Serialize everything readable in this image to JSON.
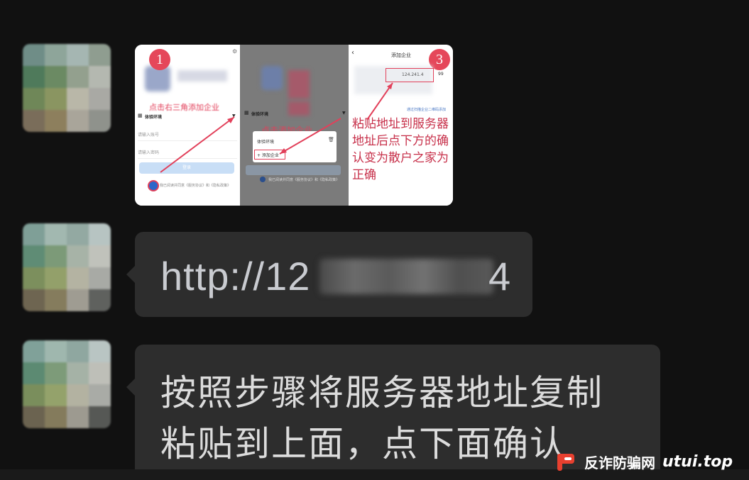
{
  "chat": {
    "image_message": {
      "step_badges": [
        "1",
        "3"
      ],
      "panel1": {
        "annotation": "点击右三角添加企业",
        "env_label": "体验环境",
        "account_placeholder": "请输入账号",
        "password_placeholder": "请输入密码",
        "login_label": "登录",
        "agreement_text": "我已阅读并同意《服务协议》和《隐私政策》"
      },
      "panel2": {
        "env_label": "体验环境",
        "annotation": "点击添加企业",
        "menu_item_env": "体验环境",
        "menu_item_add": "+ 添加企业",
        "agreement_text": "我已阅读并同意《服务协议》和《隐私政策》"
      },
      "panel3": {
        "header_title": "添加企业",
        "server_field_value": "124.241.4",
        "server_suffix": "99",
        "scan_link": "通过扫描企业二维码添加",
        "instruction": "粘贴地址到服务器地址后点下方的确认变为散户之家为正确"
      }
    },
    "url_message": {
      "prefix": "http://12",
      "suffix": "4"
    },
    "text_message": {
      "line1": "按照步骤将服务器地址复制",
      "line2": "粘贴到上面，点下面确认"
    }
  },
  "watermark": {
    "name": "反诈防骗网",
    "url": "utui.top",
    "brand_color": "#e8402f"
  }
}
